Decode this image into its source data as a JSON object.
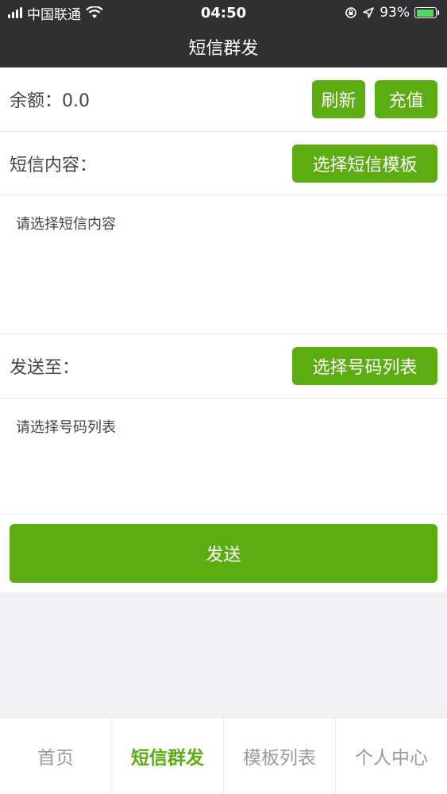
{
  "status_bar": {
    "carrier": "中国联通",
    "time": "04:50",
    "battery": "93%",
    "battery_level": 0.93,
    "icons": [
      "signal-icon",
      "wifi-icon",
      "orientation-lock-icon",
      "location-icon",
      "battery-icon"
    ]
  },
  "navbar": {
    "title": "短信群发"
  },
  "balance": {
    "label": "余额：",
    "value": "0.0",
    "refresh_label": "刷新",
    "recharge_label": "充值"
  },
  "content": {
    "label": "短信内容：",
    "select_template_label": "选择短信模板",
    "placeholder": "请选择短信内容"
  },
  "recipients": {
    "label": "发送至：",
    "select_list_label": "选择号码列表",
    "placeholder": "请选择号码列表"
  },
  "send": {
    "label": "发送"
  },
  "tabbar": {
    "tabs": [
      {
        "label": "首页"
      },
      {
        "label": "短信群发"
      },
      {
        "label": "模板列表"
      },
      {
        "label": "个人中心"
      }
    ],
    "active_index": 1
  },
  "colors": {
    "accent": "#5cad11",
    "bar_bg": "#303033",
    "page_bg": "#f2f1f6"
  }
}
